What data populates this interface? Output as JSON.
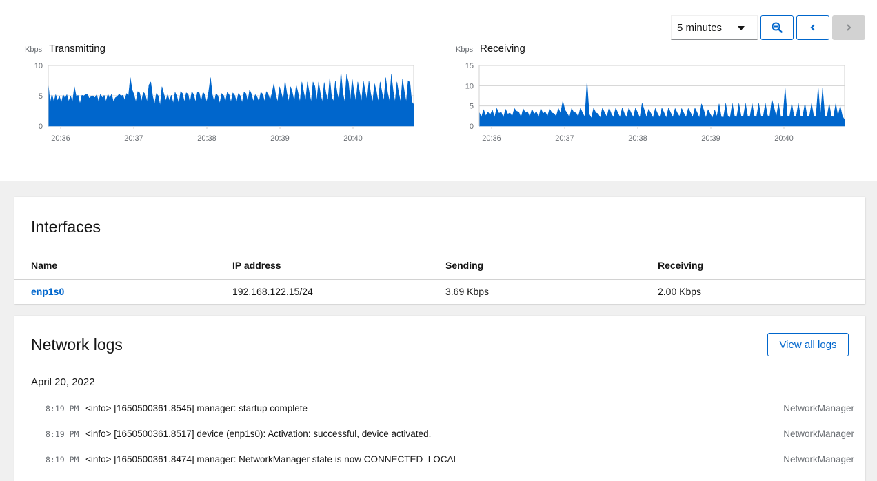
{
  "toolbar": {
    "range_select": "5 minutes",
    "zoom_out_label": "Zoom out",
    "prev_label": "Previous",
    "next_label": "Next"
  },
  "colors": {
    "accent": "#0066cc",
    "series": "#0066cc",
    "grid": "#d2d2d2"
  },
  "chart_data": [
    {
      "type": "area",
      "title": "Transmitting",
      "ylabel": "Kbps",
      "ylim": [
        0,
        10
      ],
      "yticks": [
        "0",
        "5",
        "10"
      ],
      "xticks": [
        "20:36",
        "20:37",
        "20:38",
        "20:39",
        "20:40"
      ],
      "x_range_minutes": [
        -0.17,
        4.83
      ],
      "grid": true,
      "values": [
        7,
        3.8,
        5.3,
        4,
        5.2,
        4.2,
        5,
        3.8,
        5.2,
        4.6,
        5.2,
        4.1,
        5,
        4,
        6.5,
        4.9,
        5.1,
        3.7,
        5.1,
        5,
        5.2,
        5.2,
        4.6,
        4.9,
        5,
        4.7,
        5.2,
        4,
        5.3,
        4.7,
        5.1,
        4.1,
        5.3,
        4.6,
        5.3,
        4,
        4.7,
        4.9,
        5.3,
        5,
        5.1,
        4.3,
        5.4,
        5,
        8,
        6,
        5.2,
        4,
        5.7,
        5.5,
        4.1,
        5.6,
        5.3,
        4,
        6.8,
        7.3,
        5,
        3.6,
        5.4,
        5,
        3.4,
        6.5,
        5.3,
        4.2,
        5.2,
        4.2,
        5.1,
        3.8,
        5.6,
        4.9,
        3.7,
        5.7,
        5.4,
        4,
        5.5,
        5.3,
        3.8,
        5.7,
        5.2,
        4,
        5.6,
        5.5,
        4,
        5.6,
        5.2,
        4,
        5.7,
        8,
        5.2,
        4,
        5.4,
        5,
        3.8,
        5.4,
        5.1,
        4,
        5.6,
        5.2,
        4,
        5.5,
        5.1,
        4,
        5.4,
        5,
        3.9,
        5.6,
        5.4,
        4,
        6,
        5.3,
        4.1,
        5.2,
        4.8,
        4,
        5.6,
        5.3,
        4.1,
        5.7,
        5.2,
        4.3,
        5.5,
        7,
        5.2,
        4,
        6.5,
        5.5,
        4.2,
        7.5,
        5.4,
        4.1,
        6.5,
        5.5,
        4,
        6.8,
        5.5,
        4,
        7.3,
        5.6,
        4.2,
        7.3,
        5.5,
        4,
        7.3,
        6.6,
        4.2,
        7.3,
        5.3,
        4,
        7.2,
        5.4,
        4.2,
        8,
        4.8,
        4.1,
        7.5,
        5.4,
        4.2,
        9,
        5.5,
        4,
        8.5,
        7.2,
        4.1,
        7.8,
        5.7,
        4,
        7.3,
        5.6,
        4.1,
        7.5,
        5.8,
        4.2,
        7.5,
        5.3,
        4,
        7,
        5.8,
        4,
        7.3,
        5.6,
        4.2,
        8,
        5.6,
        4.1,
        8.5,
        5.8,
        4,
        7.3,
        5.4,
        4,
        7.8,
        5.7,
        4,
        7.5,
        7.2,
        4,
        3.6
      ]
    },
    {
      "type": "area",
      "title": "Receiving",
      "ylabel": "Kbps",
      "ylim": [
        0,
        15
      ],
      "yticks": [
        "0",
        "5",
        "10",
        "15"
      ],
      "xticks": [
        "20:36",
        "20:37",
        "20:38",
        "20:39",
        "20:40"
      ],
      "x_range_minutes": [
        -0.17,
        4.83
      ],
      "grid": true,
      "values": [
        3.5,
        2.2,
        4.1,
        2.6,
        3.5,
        2.8,
        4,
        2.2,
        4.4,
        3.2,
        3.5,
        2.1,
        4.2,
        3,
        3.3,
        2.4,
        4.4,
        3.7,
        3.5,
        2.2,
        4.3,
        3.3,
        3.6,
        2.3,
        4.2,
        3,
        3.6,
        2.2,
        4.4,
        3.1,
        3.6,
        2.4,
        4.3,
        3.3,
        3.1,
        2.4,
        4.4,
        3.2,
        6.2,
        4,
        3.2,
        2.2,
        4.4,
        3.4,
        3.3,
        2.3,
        4.5,
        3.2,
        2.3,
        11.2,
        3,
        2,
        4.5,
        3.3,
        3.1,
        2.1,
        4.5,
        3.3,
        2.3,
        4.5,
        3.1,
        2.2,
        4.5,
        3.3,
        2.2,
        4.5,
        3.1,
        2.2,
        4.5,
        3.3,
        2.2,
        4.5,
        3.3,
        2.1,
        5.7,
        4,
        2.2,
        4.2,
        3.2,
        2.1,
        4.4,
        3.2,
        2.2,
        4.5,
        3.3,
        2.1,
        4.5,
        3.3,
        2.2,
        4.4,
        3.3,
        2.4,
        4.4,
        3.2,
        2.2,
        4.4,
        3.4,
        2.2,
        4.5,
        3.4,
        2.1,
        5.5,
        4,
        2.1,
        4.1,
        3,
        2.1,
        4,
        2.4,
        5.5,
        2.3,
        2.2,
        5.6,
        2.4,
        2.2,
        5.6,
        2.4,
        2.3,
        5.6,
        2.5,
        2.3,
        5.6,
        2.4,
        2.3,
        5.6,
        2.4,
        2.3,
        5.6,
        2.5,
        2.3,
        5.6,
        2.6,
        2.4,
        6.6,
        4.5,
        2.3,
        5.6,
        2.3,
        2.4,
        9.5,
        2.4,
        2.3,
        5.6,
        2.4,
        2.3,
        5.6,
        2.4,
        2.4,
        5.6,
        2.4,
        2.3,
        5.6,
        2.4,
        2.3,
        9.7,
        2.4,
        9.4,
        2.5,
        2.3,
        5.5,
        2.4,
        2.3,
        5.6,
        2.4,
        5,
        2.5,
        1.6
      ]
    }
  ],
  "interfaces": {
    "title": "Interfaces",
    "columns": [
      "Name",
      "IP address",
      "Sending",
      "Receiving"
    ],
    "rows": [
      {
        "name": "enp1s0",
        "ip": "192.168.122.15/24",
        "sending": "3.69 Kbps",
        "receiving": "2.00 Kbps"
      }
    ]
  },
  "logs": {
    "title": "Network logs",
    "view_all_label": "View all logs",
    "date": "April 20, 2022",
    "entries": [
      {
        "time": "8:19 PM",
        "message": "<info> [1650500361.8545] manager: startup complete",
        "source": "NetworkManager"
      },
      {
        "time": "8:19 PM",
        "message": "<info> [1650500361.8517] device (enp1s0): Activation: successful, device activated.",
        "source": "NetworkManager"
      },
      {
        "time": "8:19 PM",
        "message": "<info> [1650500361.8474] manager: NetworkManager state is now CONNECTED_LOCAL",
        "source": "NetworkManager"
      }
    ]
  }
}
